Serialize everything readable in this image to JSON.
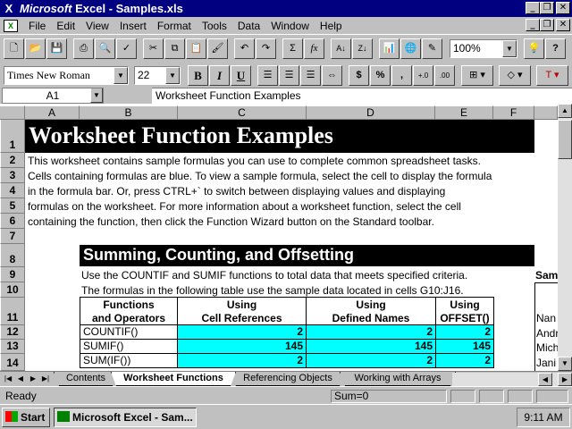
{
  "window": {
    "title_app": "Microsoft",
    "title_rest": " Excel - Samples.xls"
  },
  "menu": {
    "items": [
      "File",
      "Edit",
      "View",
      "Insert",
      "Format",
      "Tools",
      "Data",
      "Window",
      "Help"
    ]
  },
  "toolbar": {
    "zoom": "100%"
  },
  "format_toolbar": {
    "font_name": "Times New Roman",
    "font_size": "22",
    "bold_label": "B",
    "italic_label": "I",
    "underline_label": "U",
    "currency_label": "$",
    "percent_label": "%",
    "comma_label": ","
  },
  "formula_bar": {
    "name_box": "A1",
    "content": "Worksheet Function Examples"
  },
  "grid": {
    "columns": [
      "A",
      "B",
      "C",
      "D",
      "E",
      "F"
    ],
    "rows": [
      "1",
      "2",
      "3",
      "4",
      "5",
      "6",
      "7",
      "8",
      "9",
      "10",
      "11",
      "12",
      "13",
      "14"
    ],
    "title": "Worksheet Function Examples",
    "intro_lines": [
      "This worksheet contains sample formulas you can use to complete common spreadsheet tasks.",
      "Cells containing formulas are blue.  To view a sample formula, select the cell to display the formula",
      "in the formula bar. Or, press CTRL+` to switch between displaying values and displaying",
      "formulas on the worksheet. For more information about a worksheet function, select the cell",
      "containing the function, then click the Function Wizard button on the Standard toolbar."
    ],
    "section_title": "Summing, Counting, and Offsetting",
    "row9_text": "Use the COUNTIF and SUMIF functions to total data that meets specified criteria.",
    "row10_text": "The formulas in the following table use the sample data located in cells G10:J16.",
    "right_label_sam": "Sam",
    "right_names": [
      "Nan",
      "Andr",
      "Mich",
      "Jani"
    ],
    "table": {
      "headers": [
        [
          "Functions",
          "and Operators"
        ],
        [
          "Using",
          "Cell References"
        ],
        [
          "Using",
          "Defined Names"
        ],
        [
          "Using",
          "OFFSET()"
        ]
      ],
      "rows": [
        {
          "fn": "COUNTIF()",
          "c": "2",
          "d": "2",
          "e": "2"
        },
        {
          "fn": "SUMIF()",
          "c": "145",
          "d": "145",
          "e": "145"
        },
        {
          "fn": "SUM(IF())",
          "c": "2",
          "d": "2",
          "e": "2"
        }
      ]
    }
  },
  "sheet_tabs": [
    "Contents",
    "Worksheet Functions",
    "Referencing Objects",
    "Working with Arrays"
  ],
  "active_tab": "Worksheet Functions",
  "status": {
    "mode": "Ready",
    "sum": "Sum=0"
  },
  "taskbar": {
    "start_label": "Start",
    "task_label": "Microsoft Excel - Sam...",
    "clock": "9:11 AM"
  },
  "colors": {
    "titlebar": "#000080",
    "formula_cell": "#00ffff",
    "title_band": "#000000",
    "desktop": "#008080"
  }
}
